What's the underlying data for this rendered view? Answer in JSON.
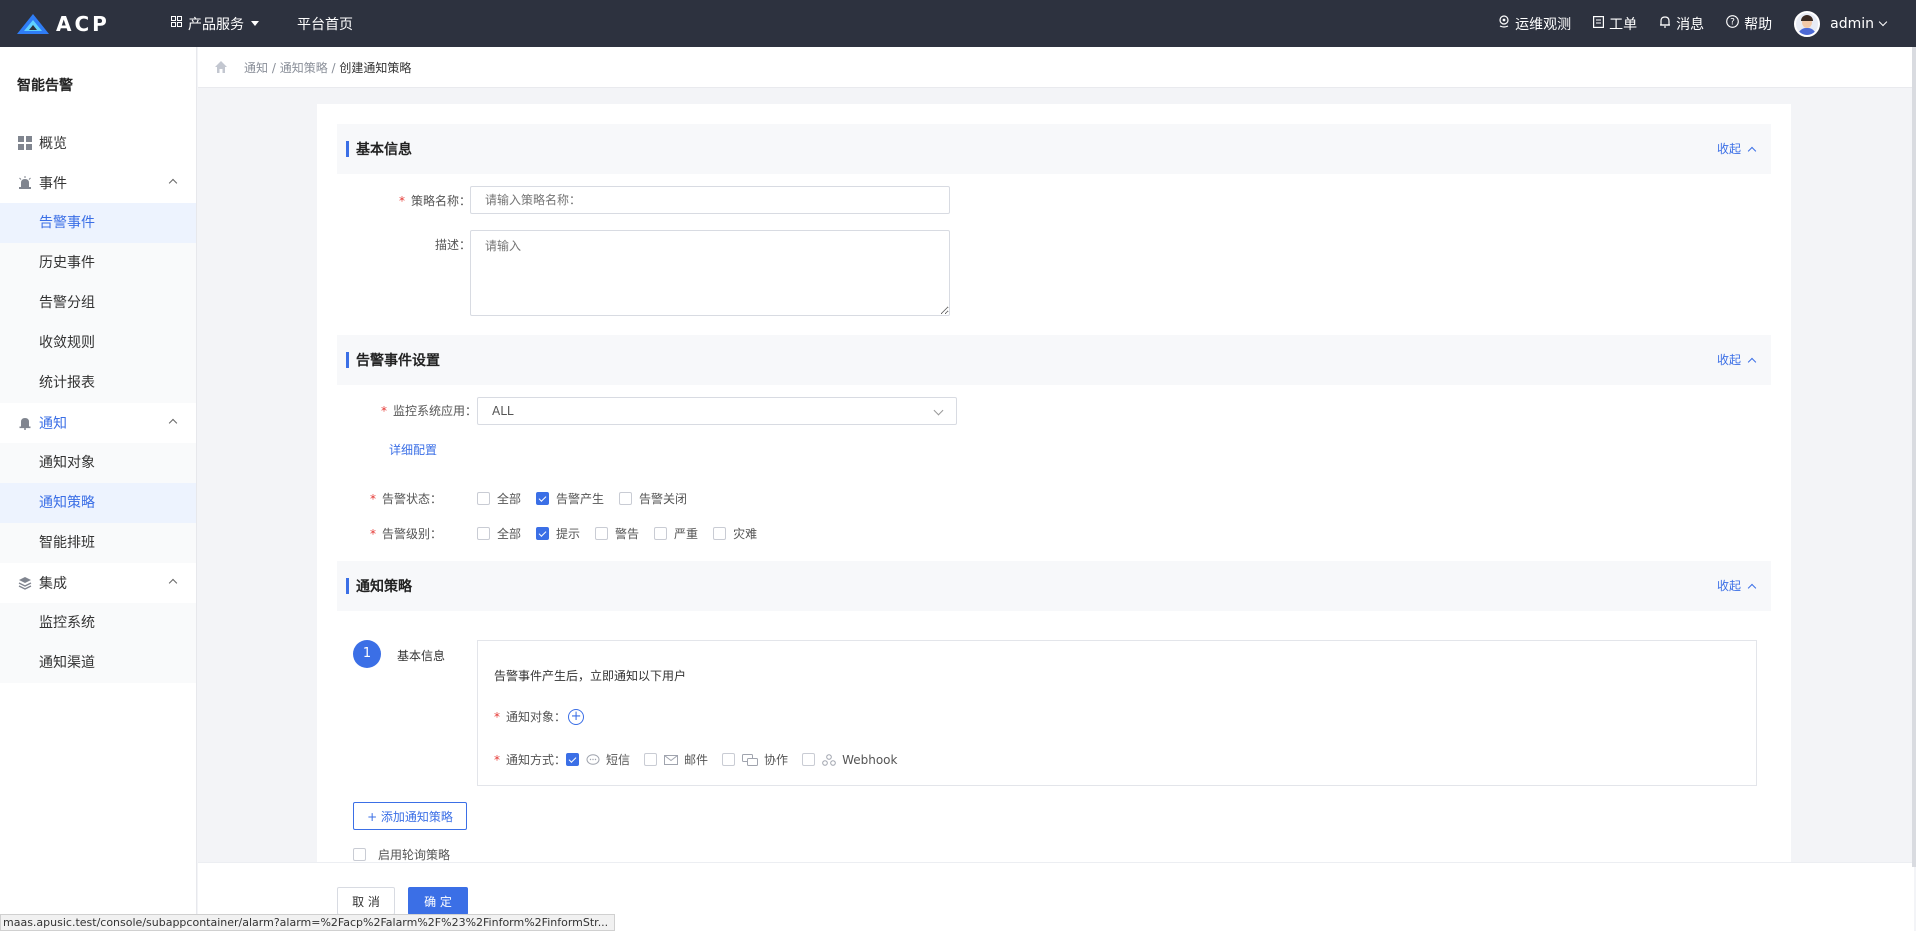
{
  "topbar": {
    "logo_text": "ACP",
    "nav": [
      {
        "label": "产品服务",
        "icon": "grid-icon",
        "has_caret": true
      },
      {
        "label": "平台首页"
      }
    ],
    "right": [
      {
        "label": "运维观测",
        "icon": "location-icon"
      },
      {
        "label": "工单",
        "icon": "clipboard-icon"
      },
      {
        "label": "消息",
        "icon": "bell-icon"
      },
      {
        "label": "帮助",
        "icon": "question-icon"
      }
    ],
    "user": "admin"
  },
  "sidebar": {
    "title": "智能告警",
    "overview": "概览",
    "groups": [
      {
        "label": "事件",
        "icon": "alarm-icon",
        "items": [
          "告警事件",
          "历史事件",
          "告警分组",
          "收敛规则",
          "统计报表"
        ]
      },
      {
        "label": "通知",
        "icon": "bell-icon",
        "items": [
          "通知对象",
          "通知策略",
          "智能排班"
        ]
      },
      {
        "label": "集成",
        "icon": "layers-icon",
        "items": [
          "监控系统",
          "通知渠道"
        ]
      }
    ],
    "active_group": "通知",
    "active_items": [
      "告警事件",
      "通知策略"
    ]
  },
  "breadcrumb": {
    "parts": [
      "通知",
      "通知策略"
    ],
    "current": "创建通知策略",
    "sep": " / "
  },
  "basic": {
    "title": "基本信息",
    "collapse": "收起",
    "name_label": "策略名称：",
    "name_placeholder": "请输入策略名称：",
    "desc_label": "描述：",
    "desc_placeholder": "请输入"
  },
  "alarm": {
    "title": "告警事件设置",
    "collapse": "收起",
    "app_label": "监控系统应用：",
    "app_value": "ALL",
    "detail_link": "详细配置",
    "status_label": "告警状态：",
    "status_options": [
      {
        "label": "全部",
        "checked": false
      },
      {
        "label": "告警产生",
        "checked": true
      },
      {
        "label": "告警关闭",
        "checked": false
      }
    ],
    "level_label": "告警级别：",
    "level_options": [
      {
        "label": "全部",
        "checked": false
      },
      {
        "label": "提示",
        "checked": true
      },
      {
        "label": "警告",
        "checked": false
      },
      {
        "label": "严重",
        "checked": false
      },
      {
        "label": "灾难",
        "checked": false
      }
    ]
  },
  "notify": {
    "title": "通知策略",
    "collapse": "收起",
    "step_number": "1",
    "step_label": "基本信息",
    "desc": "告警事件产生后，立即通知以下用户",
    "target_label": "通知对象：",
    "method_label": "通知方式：",
    "methods": [
      {
        "label": "短信",
        "checked": true,
        "icon": "chat-icon"
      },
      {
        "label": "邮件",
        "checked": false,
        "icon": "mail-icon"
      },
      {
        "label": "协作",
        "checked": false,
        "icon": "collab-icon"
      },
      {
        "label": "Webhook",
        "checked": false,
        "icon": "webhook-icon"
      }
    ],
    "add_button": "+ 添加通知策略",
    "polling_label": "启用轮询策略",
    "polling_checked": false
  },
  "footer": {
    "cancel": "取 消",
    "ok": "确 定"
  },
  "status_url": "maas.apusic.test/console/subappcontainer/alarm?alarm=%2Facp%2Falarm%2F%23%2Finform%2FinformStr..."
}
